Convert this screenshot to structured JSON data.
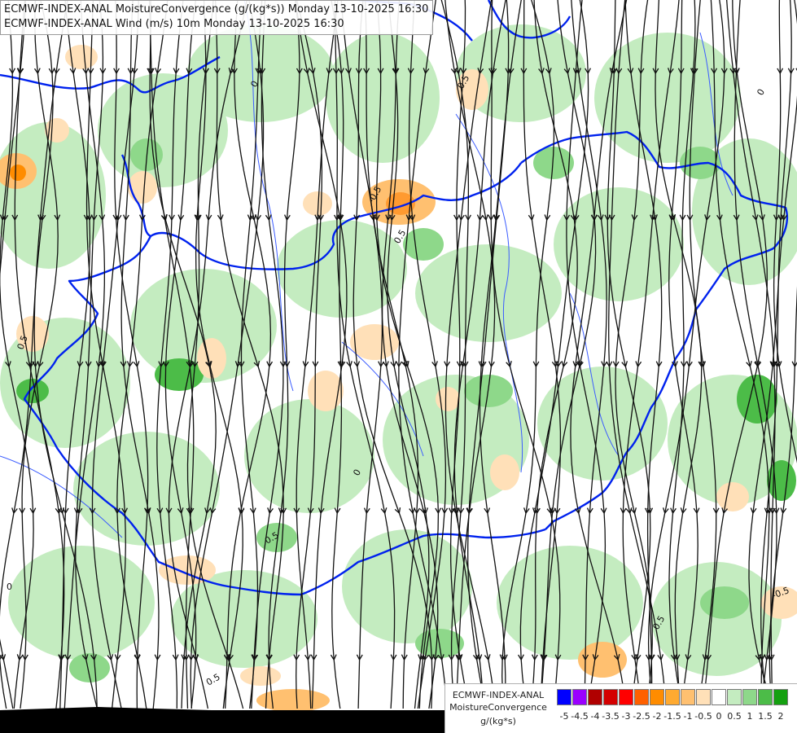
{
  "title": {
    "line1": "ECMWF-INDEX-ANAL MoistureConvergence (g/(kg*s)) Monday 13-10-2025 16:30",
    "line2": "ECMWF-INDEX-ANAL Wind (m/s) 10m Monday 13-10-2025 16:30"
  },
  "legend": {
    "model": "ECMWF-INDEX-ANAL",
    "variable": "MoistureConvergence",
    "unit": "g/(kg*s)",
    "ticks": [
      "-5",
      "-4.5",
      "-4",
      "-3.5",
      "-3",
      "-2.5",
      "-2",
      "-1.5",
      "-1",
      "-0.5",
      "0",
      "0.5",
      "1",
      "1.5",
      "2"
    ],
    "colors": [
      "#0000ff",
      "#9a00ff",
      "#b00000",
      "#d40000",
      "#ff0000",
      "#ff6000",
      "#ff8c00",
      "#ffaa30",
      "#ffc070",
      "#ffe0b8",
      "#ffffff",
      "#c4ecc0",
      "#8ed88a",
      "#4cbc48",
      "#14a010"
    ]
  },
  "map": {
    "contour_labels": [
      "0",
      "0.5",
      "0.5",
      "-0.5",
      "0.5",
      "0",
      "0.5",
      "-0.5",
      "0",
      "0.5",
      "0",
      "0.5"
    ],
    "colors": {
      "border": "#0022ee",
      "river": "#3b5cff",
      "streamline": "#111111",
      "land_bottom": "#000000"
    }
  }
}
